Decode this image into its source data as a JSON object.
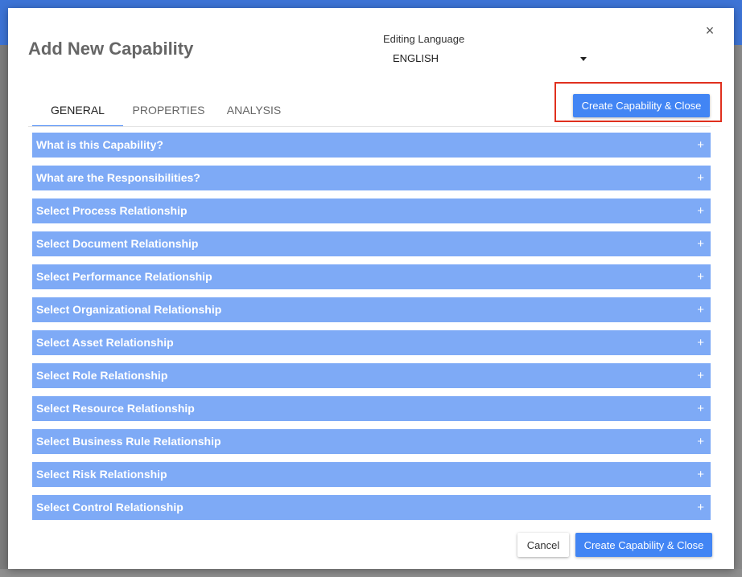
{
  "dialog": {
    "title": "Add New Capability",
    "editing_language_label": "Editing Language",
    "language_value": "ENGLISH",
    "close_glyph": "×"
  },
  "tabs": [
    {
      "label": "GENERAL",
      "active": true
    },
    {
      "label": "PROPERTIES",
      "active": false
    },
    {
      "label": "ANALYSIS",
      "active": false
    }
  ],
  "top_button_label": "Create Capability & Close",
  "sections": [
    {
      "label": "What is this Capability?",
      "icon": "+"
    },
    {
      "label": "What are the Responsibilities?",
      "icon": "+"
    },
    {
      "label": "Select Process Relationship",
      "icon": "+"
    },
    {
      "label": "Select Document Relationship",
      "icon": "+"
    },
    {
      "label": "Select Performance Relationship",
      "icon": "+"
    },
    {
      "label": "Select Organizational Relationship",
      "icon": "+"
    },
    {
      "label": "Select Asset Relationship",
      "icon": "+"
    },
    {
      "label": "Select Role Relationship",
      "icon": "+"
    },
    {
      "label": "Select Resource Relationship",
      "icon": "+"
    },
    {
      "label": "Select Business Rule Relationship",
      "icon": "+"
    },
    {
      "label": "Select Risk Relationship",
      "icon": "+"
    },
    {
      "label": "Select Control Relationship",
      "icon": "+"
    }
  ],
  "footer": {
    "cancel_label": "Cancel",
    "create_label": "Create Capability & Close"
  },
  "colors": {
    "accent": "#4285f4",
    "section_bg": "#7eaaf6",
    "highlight": "#e0301e",
    "app_bar": "#3d74d6"
  },
  "icons": {
    "close": "close-icon",
    "dropdown": "caret-down-icon",
    "expand": "plus-icon"
  }
}
